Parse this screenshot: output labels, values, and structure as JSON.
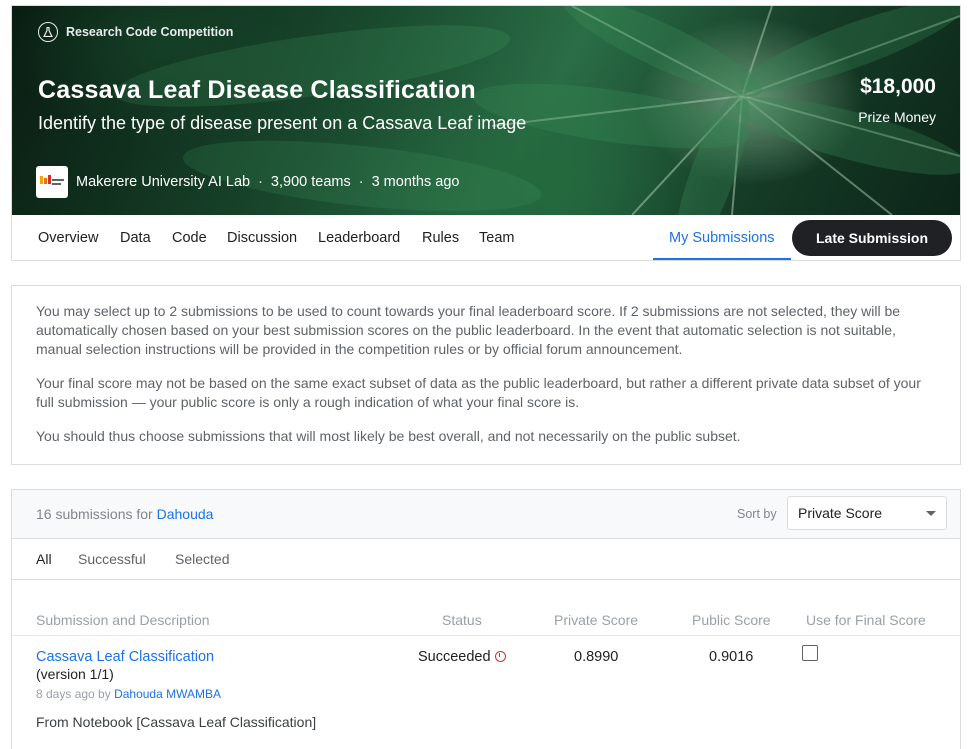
{
  "competition": {
    "type_label": "Research Code Competition",
    "title": "Cassava Leaf Disease Classification",
    "subtitle": "Identify the type of disease present on a Cassava Leaf image",
    "prize_amount": "$18,000",
    "prize_label": "Prize Money",
    "host": "Makerere University AI Lab",
    "teams": "3,900 teams",
    "age": "3 months ago",
    "separator": "·"
  },
  "tabs": [
    {
      "label": "Overview"
    },
    {
      "label": "Data"
    },
    {
      "label": "Code"
    },
    {
      "label": "Discussion"
    },
    {
      "label": "Leaderboard"
    },
    {
      "label": "Rules"
    },
    {
      "label": "Team"
    },
    {
      "label": "My Submissions",
      "active": true
    }
  ],
  "late_submission_label": "Late Submission",
  "info": {
    "p1": "You may select up to 2 submissions to be used to count towards your final leaderboard score. If 2 submissions are not selected, they will be automatically chosen based on your best submission scores on the public leaderboard. In the event that automatic selection is not suitable, manual selection instructions will be provided in the competition rules or by official forum announcement.",
    "p2": "Your final score may not be based on the same exact subset of data as the public leaderboard, but rather a different private data subset of your full submission — your public score is only a rough indication of what your final score is.",
    "p3": "You should thus choose submissions that will most likely be best overall, and not necessarily on the public subset."
  },
  "submissions": {
    "count_text": "16 submissions for",
    "user": "Dahouda",
    "sort_label": "Sort by",
    "sort_value": "Private Score",
    "filters": [
      "All",
      "Successful",
      "Selected"
    ],
    "columns": {
      "description": "Submission and Description",
      "status": "Status",
      "private": "Private Score",
      "public": "Public Score",
      "final": "Use for Final Score"
    },
    "rows": [
      {
        "title": "Cassava Leaf Classification",
        "version": "(version 1/1)",
        "ago": "8 days ago by",
        "author": "Dahouda MWAMBA",
        "description": "From Notebook [Cassava Leaf Classification]",
        "status": "Succeeded",
        "private_score": "0.8990",
        "public_score": "0.9016"
      }
    ]
  },
  "colors": {
    "accent": "#1a73e8",
    "dark_button": "#202124",
    "error": "#d93025"
  }
}
